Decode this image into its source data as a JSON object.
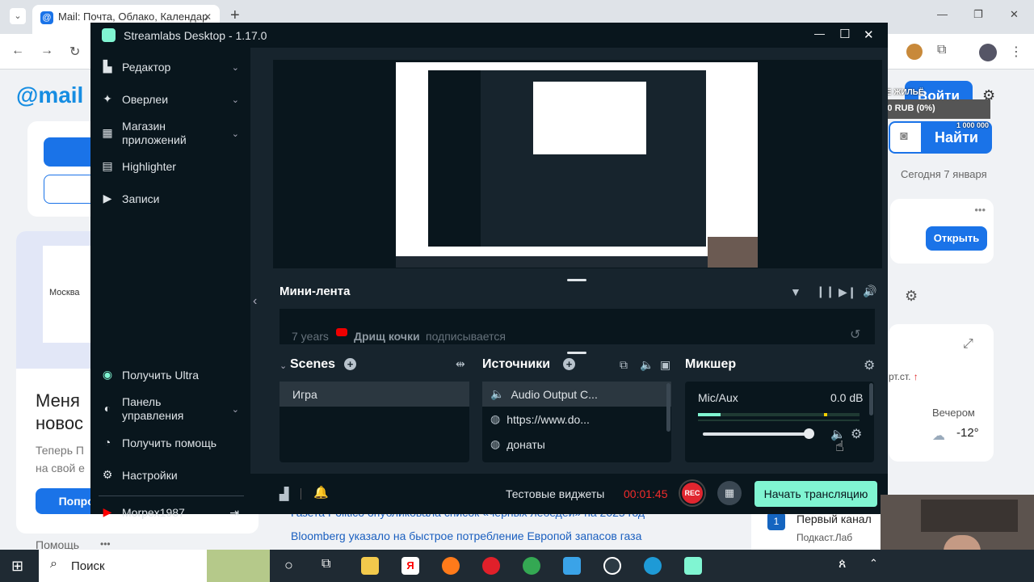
{
  "browser": {
    "tab_title": "Mail: Почта, Облако, Календар",
    "tab_close": "✕",
    "new_tab": "+",
    "window_controls": {
      "minimize": "—",
      "restore": "❐",
      "close": "✕"
    }
  },
  "mail": {
    "logo_text": "mail",
    "city": "Москва",
    "headline": "Меня",
    "headline2": "новос",
    "subtext": "Теперь П",
    "subtext2": "на свой е",
    "try_button": "Попроб",
    "help_link": "Помощь",
    "more": "•••",
    "login_button": "Войти",
    "search_button": "Найти",
    "date": "Сегодня 7 января",
    "open_button": "Открыть",
    "temp_label": "рт.ст.",
    "evening_label": "Вечером",
    "evening_temp": "-12°",
    "news": [
      "Газета Politico опубликовала список «черных лебедей» на 2025 год",
      "Bloomberg указало на быстрое потребление Европой запасов газа"
    ],
    "channel_name": "Первый канал",
    "channel_sub": "Подкаст.Лаб"
  },
  "overlay": {
    "goal_label": "НА НОВОЕ ЖИЛЬЁ",
    "goal_progress": "0 / 1 000 000 RUB (0%)",
    "goal_start": "0",
    "goal_end": "1 000 000",
    "goal_fraction": 0
  },
  "streamlabs": {
    "title": "Streamlabs Desktop - 1.17.0",
    "window_controls": {
      "minimize": "—",
      "maximize": "☐",
      "close": "✕"
    },
    "sidebar_top": [
      {
        "label": "Редактор",
        "icon": "editor-icon"
      },
      {
        "label": "Оверлеи",
        "icon": "overlays-icon"
      },
      {
        "label": "Магазин приложений",
        "icon": "app-store-icon"
      },
      {
        "label": "Highlighter",
        "icon": "highlighter-icon"
      },
      {
        "label": "Записи",
        "icon": "recordings-icon"
      }
    ],
    "sidebar_bottom": [
      {
        "label": "Получить Ultra",
        "icon": "ultra-icon"
      },
      {
        "label": "Панель управления",
        "icon": "dashboard-icon"
      },
      {
        "label": "Получить помощь",
        "icon": "help-icon"
      },
      {
        "label": "Настройки",
        "icon": "settings-icon"
      }
    ],
    "user": "Morpex1987",
    "minifeed": {
      "title": "Мини-лента",
      "event_time": "7 years",
      "event_user": "Дрищ кочки",
      "event_action": "подписывается"
    },
    "scenes": {
      "title": "Scenes",
      "items": [
        "Игра"
      ]
    },
    "sources": {
      "title": "Источники",
      "items": [
        {
          "label": "Audio Output C...",
          "icon": "speaker-icon"
        },
        {
          "label": "https://www.do...",
          "icon": "globe-icon"
        },
        {
          "label": "донаты",
          "icon": "globe-icon"
        }
      ]
    },
    "mixer": {
      "title": "Микшер",
      "channel": "Mic/Aux",
      "level": "0.0 dB",
      "volume_fraction": 1.0
    },
    "footer": {
      "widgets_label": "Тестовые виджеты",
      "timer": "00:01:45",
      "rec": "REC",
      "go_live": "Начать трансляцию"
    }
  },
  "taskbar": {
    "search_placeholder": "Поиск"
  },
  "colors": {
    "sl_bg": "#17242d",
    "sl_dark": "#09161d",
    "sl_accent": "#80f5d2",
    "rec_red": "#e0262f",
    "timer_red": "#f22b2b",
    "mail_blue": "#1a73e8"
  }
}
